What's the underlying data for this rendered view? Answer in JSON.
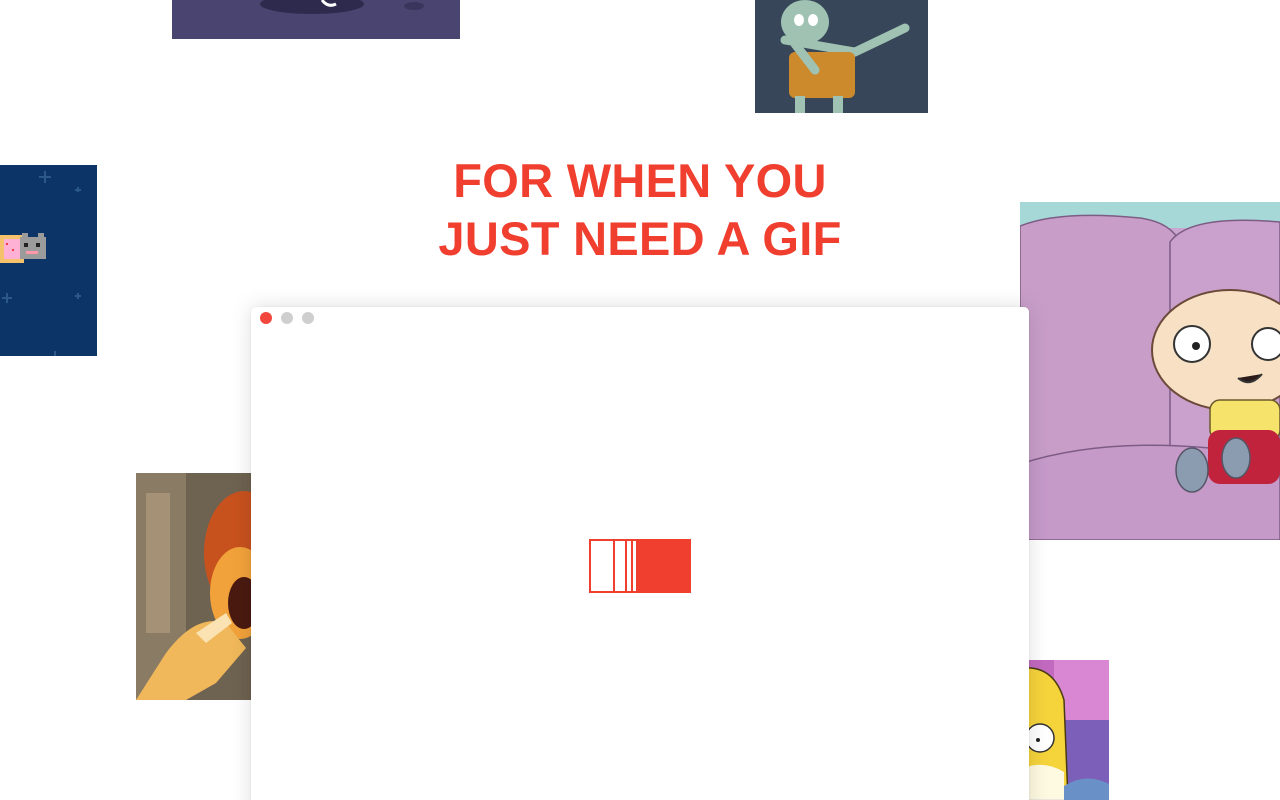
{
  "headline": {
    "line1": "FOR WHEN YOU",
    "line2": "JUST NEED A GIF"
  },
  "colors": {
    "accent": "#f03e2f",
    "window_close": "#f2473d",
    "window_inactive": "#cfcfcf",
    "background": "#ffffff"
  },
  "window": {
    "controls": [
      "close",
      "minimize",
      "zoom"
    ]
  },
  "gif_tiles": [
    {
      "name": "tile-top-left",
      "depicts": "purple-scene"
    },
    {
      "name": "tile-top-right",
      "depicts": "squidward-dab"
    },
    {
      "name": "tile-left",
      "depicts": "nyan-cat"
    },
    {
      "name": "tile-right",
      "depicts": "stewie-on-couch"
    },
    {
      "name": "tile-bottom-left",
      "depicts": "muppet-animal"
    },
    {
      "name": "tile-bottom-right",
      "depicts": "homer-simpson"
    }
  ],
  "loader": {
    "icon": "gif-loader-icon"
  }
}
